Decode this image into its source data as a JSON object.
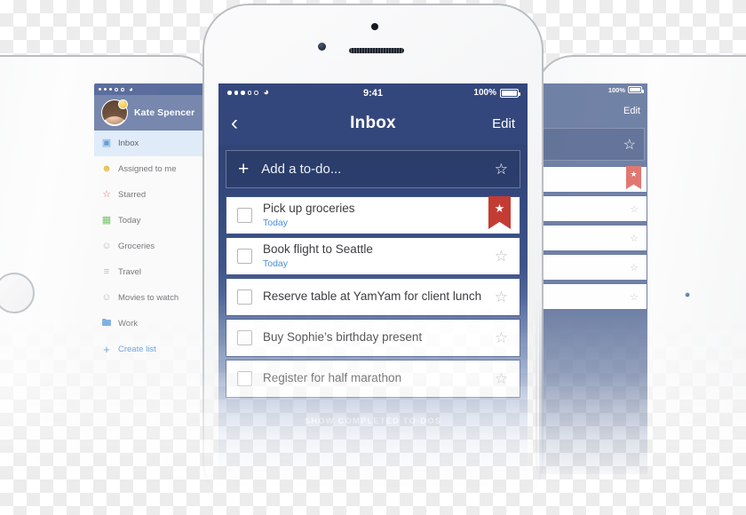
{
  "phone": {
    "status_bar": {
      "signal_filled": 3,
      "signal_empty": 2,
      "wifi_icon": "wifi-icon",
      "time": "9:41",
      "battery_percent": "100%",
      "battery_icon": "battery-full-icon"
    },
    "nav": {
      "back_icon": "chevron-left-icon",
      "title": "Inbox",
      "edit_label": "Edit"
    },
    "add_row": {
      "plus_icon": "plus-icon",
      "placeholder": "Add a to-do...",
      "star_icon": "star-outline-icon"
    },
    "todos": [
      {
        "title": "Pick up groceries",
        "due": "Today",
        "starred": true,
        "checked": false
      },
      {
        "title": "Book flight to Seattle",
        "due": "Today",
        "starred": false,
        "checked": false
      },
      {
        "title": "Reserve table at YamYam for client lunch",
        "due": "",
        "starred": false,
        "checked": false
      },
      {
        "title": "Buy Sophie’s birthday present",
        "due": "",
        "starred": false,
        "checked": false
      },
      {
        "title": "Register for half marathon",
        "due": "",
        "starred": false,
        "checked": false
      }
    ],
    "show_completed_label": "SHOW COMPLETED TO-DOS"
  },
  "left_tablet": {
    "status_bar": {
      "signal_filled": 3,
      "signal_empty": 2,
      "wifi_icon": "wifi-icon"
    },
    "profile": {
      "name": "Kate Spencer",
      "avatar_icon": "avatar",
      "badge_icon": "premium-badge-icon"
    },
    "sidebar_items": [
      {
        "label": "Inbox",
        "icon": "inbox-icon",
        "color": "#5a9ad8",
        "active": true
      },
      {
        "label": "Assigned to me",
        "icon": "assigned-person-icon",
        "color": "#e8b93f",
        "active": false
      },
      {
        "label": "Starred",
        "icon": "star-icon",
        "color": "#e06a62",
        "active": false
      },
      {
        "label": "Today",
        "icon": "calendar-icon",
        "color": "#6fbf5e",
        "active": false
      },
      {
        "label": "Groceries",
        "icon": "people-icon",
        "color": "#b6b8bc",
        "active": false
      },
      {
        "label": "Travel",
        "icon": "list-icon",
        "color": "#b6b8bc",
        "active": false
      },
      {
        "label": "Movies to watch",
        "icon": "people-icon",
        "color": "#b6b8bc",
        "active": false
      },
      {
        "label": "Work",
        "icon": "folder-icon",
        "color": "#74a9de",
        "active": false
      }
    ],
    "create_list": {
      "label": "Create list",
      "icon": "plus-icon"
    }
  },
  "right_tablet": {
    "status_bar": {
      "battery_percent": "100%",
      "battery_icon": "battery-full-icon"
    },
    "nav": {
      "edit_label": "Edit"
    },
    "add_row": {
      "star_icon": "star-outline-icon"
    },
    "rows": [
      {
        "starred": true
      },
      {
        "starred": false
      },
      {
        "starred": false
      },
      {
        "starred": false
      },
      {
        "starred": false
      }
    ]
  },
  "colors": {
    "navy": "#34477c",
    "navy_dark": "#2d3f6e",
    "accent_blue": "#4a90d9",
    "ribbon_red": "#c43b33",
    "star_gray": "#b9bcc1"
  }
}
